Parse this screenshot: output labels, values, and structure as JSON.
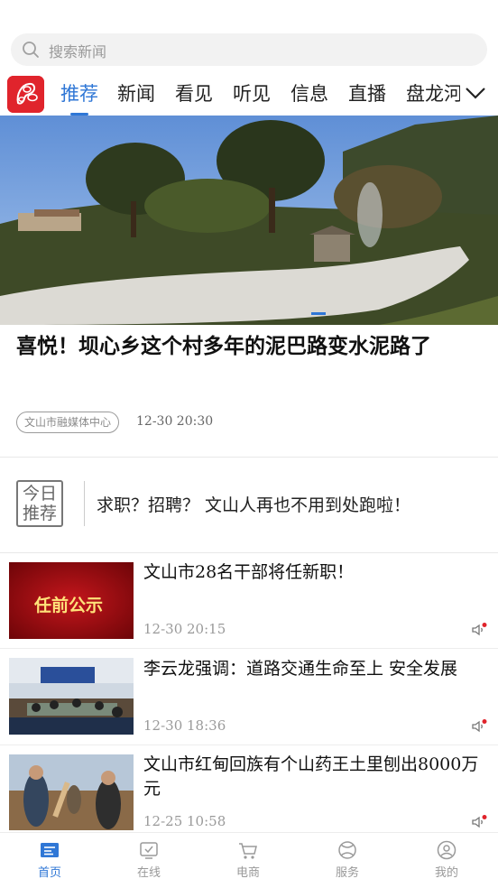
{
  "search": {
    "placeholder": "搜索新闻",
    "icon": "search-icon"
  },
  "tabs": [
    {
      "label": "推荐",
      "active": true
    },
    {
      "label": "新闻"
    },
    {
      "label": "看见"
    },
    {
      "label": "听见"
    },
    {
      "label": "信息"
    },
    {
      "label": "直播"
    },
    {
      "label": "盘龙河"
    }
  ],
  "hero": {
    "title": "喜悦！坝心乡这个村多年的泥巴路变水泥路了",
    "source": "文山市融媒体中心",
    "time": "12-30  20:30"
  },
  "today": {
    "badge_line1": "今日",
    "badge_line2": "推荐",
    "text": "求职？招聘？   文山人再也不用到处跑啦！"
  },
  "news": [
    {
      "title": "文山市28名干部将任新职！",
      "time": "12-30  20:15",
      "thumb_text": "任前公示"
    },
    {
      "title": "李云龙强调：道路交通生命至上  安全发展",
      "time": "12-30  18:36"
    },
    {
      "title": "文山市红甸回族有个山药王土里刨出8000万元",
      "time": "12-25  10:58"
    }
  ],
  "bottom_nav": [
    {
      "label": "首页",
      "icon": "home-icon",
      "active": true
    },
    {
      "label": "在线",
      "icon": "online-icon"
    },
    {
      "label": "电商",
      "icon": "cart-icon"
    },
    {
      "label": "服务",
      "icon": "service-icon"
    },
    {
      "label": "我的",
      "icon": "profile-icon"
    }
  ],
  "colors": {
    "accent": "#2f77d6",
    "brand_red": "#e0242c"
  }
}
